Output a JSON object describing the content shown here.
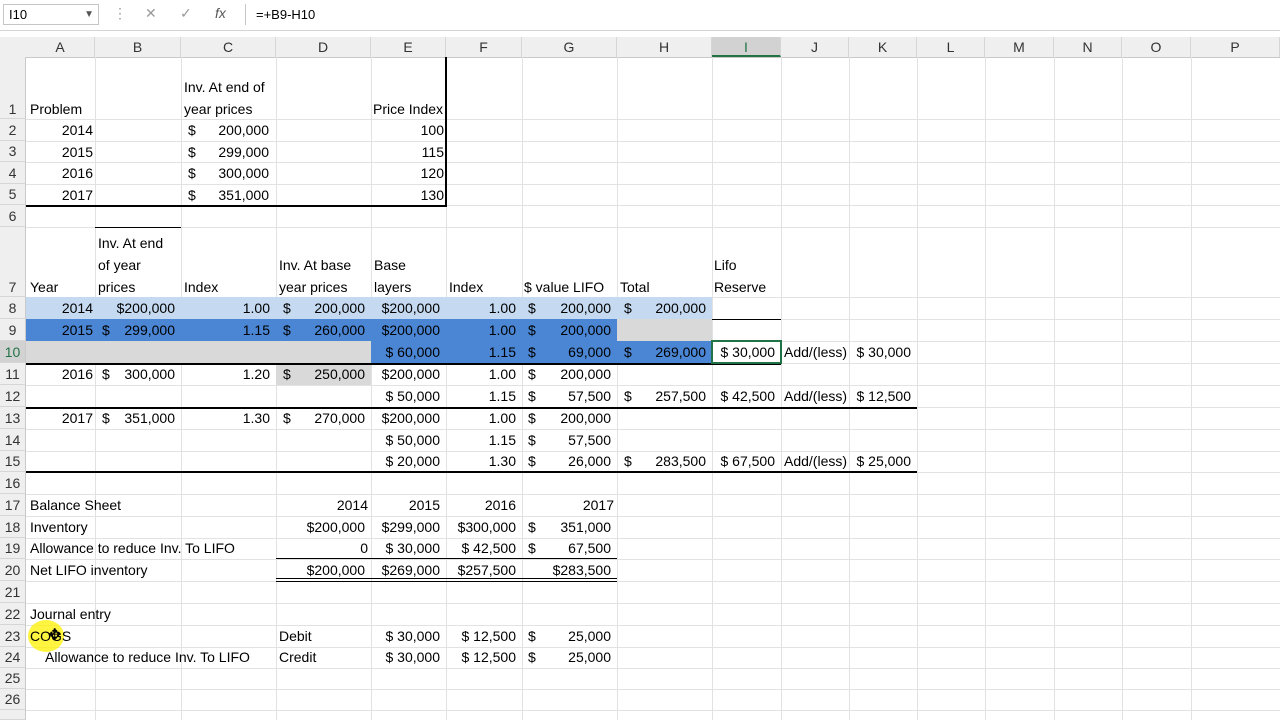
{
  "formula_bar": {
    "name_box": "I10",
    "formula": "=+B9-H10",
    "cancel": "✕",
    "enter": "✓",
    "fx": "fx"
  },
  "columns": [
    "A",
    "B",
    "C",
    "D",
    "E",
    "F",
    "G",
    "H",
    "I",
    "J",
    "K",
    "L",
    "M",
    "N",
    "O",
    "P"
  ],
  "rows": [
    "1",
    "2",
    "3",
    "4",
    "5",
    "6",
    "7",
    "8",
    "9",
    "10",
    "11",
    "12",
    "13",
    "14",
    "15",
    "16",
    "17",
    "18",
    "19",
    "20",
    "21",
    "22",
    "23",
    "24",
    "25",
    "26"
  ],
  "problem": {
    "header_c1": "Inv. At end of",
    "header_c2": "year prices",
    "label": "Problem",
    "index_label": "Price Index",
    "rows": [
      {
        "year": "2014",
        "dollar": "$",
        "amount": "200,000",
        "index": "100"
      },
      {
        "year": "2015",
        "dollar": "$",
        "amount": "299,000",
        "index": "115"
      },
      {
        "year": "2016",
        "dollar": "$",
        "amount": "300,000",
        "index": "120"
      },
      {
        "year": "2017",
        "dollar": "$",
        "amount": "351,000",
        "index": "130"
      }
    ]
  },
  "lifo": {
    "h_year": "Year",
    "h_b1": "Inv. At end",
    "h_b2": "of year",
    "h_b3": "prices",
    "h_index": "Index",
    "h_d1": "Inv. At base",
    "h_d2": "year prices",
    "h_e1": "Base",
    "h_e2": "layers",
    "h_f": "Index",
    "h_g": "$ value LIFO",
    "h_h": "Total",
    "h_i1": "Lifo",
    "h_i2": "Reserve",
    "r8": {
      "a": "2014",
      "b": "$200,000",
      "c": "1.00",
      "dd": "$",
      "d": "200,000",
      "e": "$200,000",
      "f": "1.00",
      "gd": "$",
      "g": "200,000",
      "hd": "$",
      "h": "200,000"
    },
    "r9": {
      "a": "2015",
      "bd": "$",
      "b": "299,000",
      "c": "1.15",
      "dd": "$",
      "d": "260,000",
      "e": "$200,000",
      "f": "1.00",
      "gd": "$",
      "g": "200,000"
    },
    "r10": {
      "e": "$ 60,000",
      "f": "1.15",
      "gd": "$",
      "g": "69,000",
      "hd": "$",
      "h": "269,000",
      "i": "$ 30,000",
      "j": "Add/(less)",
      "k": "$ 30,000"
    },
    "r11": {
      "a": "2016",
      "bd": "$",
      "b": "300,000",
      "c": "1.20",
      "dd": "$",
      "d": "250,000",
      "e": "$200,000",
      "f": "1.00",
      "gd": "$",
      "g": "200,000"
    },
    "r12": {
      "e": "$ 50,000",
      "f": "1.15",
      "gd": "$",
      "g": "57,500",
      "hd": "$",
      "h": "257,500",
      "i": "$ 42,500",
      "j": "Add/(less)",
      "k": "$ 12,500"
    },
    "r13": {
      "a": "2017",
      "bd": "$",
      "b": "351,000",
      "c": "1.30",
      "dd": "$",
      "d": "270,000",
      "e": "$200,000",
      "f": "1.00",
      "gd": "$",
      "g": "200,000"
    },
    "r14": {
      "e": "$ 50,000",
      "f": "1.15",
      "gd": "$",
      "g": "57,500"
    },
    "r15": {
      "e": "$ 20,000",
      "f": "1.30",
      "gd": "$",
      "g": "26,000",
      "hd": "$",
      "h": "283,500",
      "i": "$ 67,500",
      "j": "Add/(less)",
      "k": "$ 25,000"
    }
  },
  "balance": {
    "title": "Balance Sheet",
    "years": [
      "2014",
      "2015",
      "2016",
      "2017"
    ],
    "inv_label": "Inventory",
    "inv": [
      "$200,000",
      "$299,000",
      "$300,000",
      "$",
      "351,000"
    ],
    "allow_label": "Allowance to reduce Inv. To LIFO",
    "allow": [
      "0",
      "$ 30,000",
      "$ 42,500",
      "$",
      "67,500"
    ],
    "net_label": "Net LIFO inventory",
    "net": [
      "$200,000",
      "$269,000",
      "$257,500",
      "$283,500"
    ]
  },
  "journal": {
    "title": "Journal entry",
    "cogs": "COGS",
    "allow": "Allowance to reduce Inv. To LIFO",
    "debit": "Debit",
    "credit": "Credit",
    "r23": [
      "$ 30,000",
      "$ 12,500",
      "$",
      "25,000"
    ],
    "r24": [
      "$ 30,000",
      "$ 12,500",
      "$",
      "25,000"
    ]
  }
}
